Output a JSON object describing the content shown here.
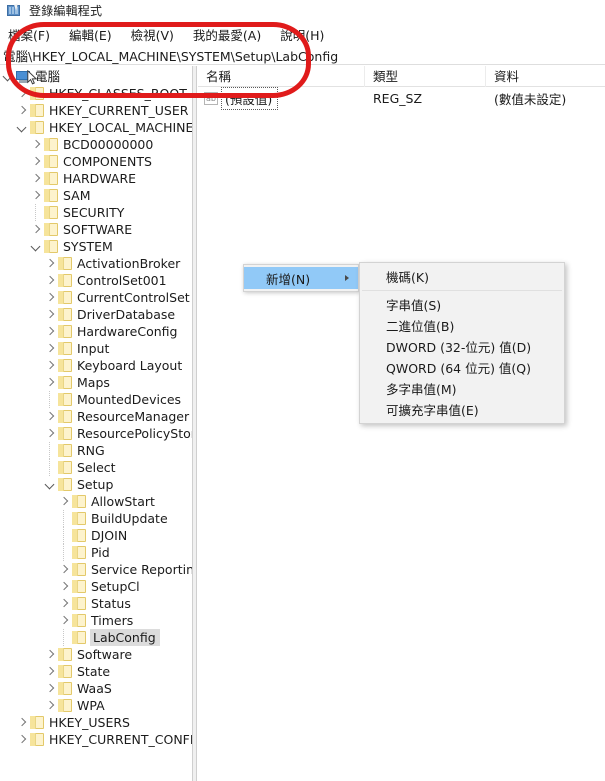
{
  "window": {
    "title": "登錄編輯程式",
    "icon": "registry-editor-icon"
  },
  "menubar": {
    "items": [
      {
        "label": "檔案(F)",
        "name": "menu-file"
      },
      {
        "label": "編輯(E)",
        "name": "menu-edit"
      },
      {
        "label": "檢視(V)",
        "name": "menu-view"
      },
      {
        "label": "我的最愛(A)",
        "name": "menu-favorites"
      },
      {
        "label": "說明(H)",
        "name": "menu-help"
      }
    ]
  },
  "address": {
    "path": "電腦\\HKEY_LOCAL_MACHINE\\SYSTEM\\Setup\\LabConfig"
  },
  "tree": {
    "nodes": [
      {
        "label": "電腦",
        "depth": 0,
        "state": "open",
        "icon": "computer-icon"
      },
      {
        "label": "HKEY_CLASSES_ROOT",
        "depth": 1,
        "state": "collapsed",
        "icon": "folder-icon"
      },
      {
        "label": "HKEY_CURRENT_USER",
        "depth": 1,
        "state": "collapsed",
        "icon": "folder-icon"
      },
      {
        "label": "HKEY_LOCAL_MACHINE",
        "depth": 1,
        "state": "open",
        "icon": "folder-icon"
      },
      {
        "label": "BCD00000000",
        "depth": 2,
        "state": "collapsed",
        "icon": "folder-icon"
      },
      {
        "label": "COMPONENTS",
        "depth": 2,
        "state": "collapsed",
        "icon": "folder-icon"
      },
      {
        "label": "HARDWARE",
        "depth": 2,
        "state": "collapsed",
        "icon": "folder-icon"
      },
      {
        "label": "SAM",
        "depth": 2,
        "state": "collapsed",
        "icon": "folder-icon"
      },
      {
        "label": "SECURITY",
        "depth": 2,
        "state": "leaf",
        "icon": "folder-icon"
      },
      {
        "label": "SOFTWARE",
        "depth": 2,
        "state": "collapsed",
        "icon": "folder-icon"
      },
      {
        "label": "SYSTEM",
        "depth": 2,
        "state": "open",
        "icon": "folder-icon"
      },
      {
        "label": "ActivationBroker",
        "depth": 3,
        "state": "collapsed",
        "icon": "folder-icon"
      },
      {
        "label": "ControlSet001",
        "depth": 3,
        "state": "collapsed",
        "icon": "folder-icon"
      },
      {
        "label": "CurrentControlSet",
        "depth": 3,
        "state": "collapsed",
        "icon": "folder-icon"
      },
      {
        "label": "DriverDatabase",
        "depth": 3,
        "state": "collapsed",
        "icon": "folder-icon"
      },
      {
        "label": "HardwareConfig",
        "depth": 3,
        "state": "collapsed",
        "icon": "folder-icon"
      },
      {
        "label": "Input",
        "depth": 3,
        "state": "collapsed",
        "icon": "folder-icon"
      },
      {
        "label": "Keyboard Layout",
        "depth": 3,
        "state": "collapsed",
        "icon": "folder-icon"
      },
      {
        "label": "Maps",
        "depth": 3,
        "state": "collapsed",
        "icon": "folder-icon"
      },
      {
        "label": "MountedDevices",
        "depth": 3,
        "state": "leaf",
        "icon": "folder-icon"
      },
      {
        "label": "ResourceManager",
        "depth": 3,
        "state": "collapsed",
        "icon": "folder-icon"
      },
      {
        "label": "ResourcePolicyStore",
        "depth": 3,
        "state": "collapsed",
        "icon": "folder-icon"
      },
      {
        "label": "RNG",
        "depth": 3,
        "state": "leaf",
        "icon": "folder-icon"
      },
      {
        "label": "Select",
        "depth": 3,
        "state": "leaf",
        "icon": "folder-icon"
      },
      {
        "label": "Setup",
        "depth": 3,
        "state": "open",
        "icon": "folder-icon"
      },
      {
        "label": "AllowStart",
        "depth": 4,
        "state": "collapsed",
        "icon": "folder-icon"
      },
      {
        "label": "BuildUpdate",
        "depth": 4,
        "state": "leaf",
        "icon": "folder-icon"
      },
      {
        "label": "DJOIN",
        "depth": 4,
        "state": "leaf",
        "icon": "folder-icon"
      },
      {
        "label": "Pid",
        "depth": 4,
        "state": "leaf",
        "icon": "folder-icon"
      },
      {
        "label": "Service Reporting A",
        "depth": 4,
        "state": "collapsed",
        "icon": "folder-icon"
      },
      {
        "label": "SetupCl",
        "depth": 4,
        "state": "collapsed",
        "icon": "folder-icon"
      },
      {
        "label": "Status",
        "depth": 4,
        "state": "collapsed",
        "icon": "folder-icon"
      },
      {
        "label": "Timers",
        "depth": 4,
        "state": "collapsed",
        "icon": "folder-icon"
      },
      {
        "label": "LabConfig",
        "depth": 4,
        "state": "leaf",
        "icon": "folder-icon",
        "selected": true
      },
      {
        "label": "Software",
        "depth": 3,
        "state": "collapsed",
        "icon": "folder-icon"
      },
      {
        "label": "State",
        "depth": 3,
        "state": "collapsed",
        "icon": "folder-icon"
      },
      {
        "label": "WaaS",
        "depth": 3,
        "state": "collapsed",
        "icon": "folder-icon"
      },
      {
        "label": "WPA",
        "depth": 3,
        "state": "collapsed",
        "icon": "folder-icon"
      },
      {
        "label": "HKEY_USERS",
        "depth": 1,
        "state": "collapsed",
        "icon": "folder-icon"
      },
      {
        "label": "HKEY_CURRENT_CONFIG",
        "depth": 1,
        "state": "collapsed",
        "icon": "folder-icon"
      }
    ]
  },
  "list": {
    "columns": [
      {
        "label": "名稱",
        "name": "column-name"
      },
      {
        "label": "類型",
        "name": "column-type"
      },
      {
        "label": "資料",
        "name": "column-data"
      }
    ],
    "rows": [
      {
        "name": "(預設值)",
        "type": "REG_SZ",
        "data": "(數值未設定)",
        "icon": "string-value-icon",
        "focused": true
      }
    ]
  },
  "context_menu": {
    "root": {
      "label": "新增(N)",
      "highlighted": true,
      "has_submenu": true
    },
    "submenu": [
      {
        "label": "機碼(K)",
        "name": "ctx-new-key"
      },
      {
        "separator": true
      },
      {
        "label": "字串值(S)",
        "name": "ctx-new-string"
      },
      {
        "label": "二進位值(B)",
        "name": "ctx-new-binary"
      },
      {
        "label": "DWORD (32-位元) 值(D)",
        "name": "ctx-new-dword"
      },
      {
        "label": "QWORD (64 位元) 值(Q)",
        "name": "ctx-new-qword"
      },
      {
        "label": "多字串值(M)",
        "name": "ctx-new-multistring"
      },
      {
        "label": "可擴充字串值(E)",
        "name": "ctx-new-expandstring"
      }
    ]
  },
  "annotation": {
    "color": "#e01b1b",
    "shape": "rounded-rectangle-highlight"
  }
}
